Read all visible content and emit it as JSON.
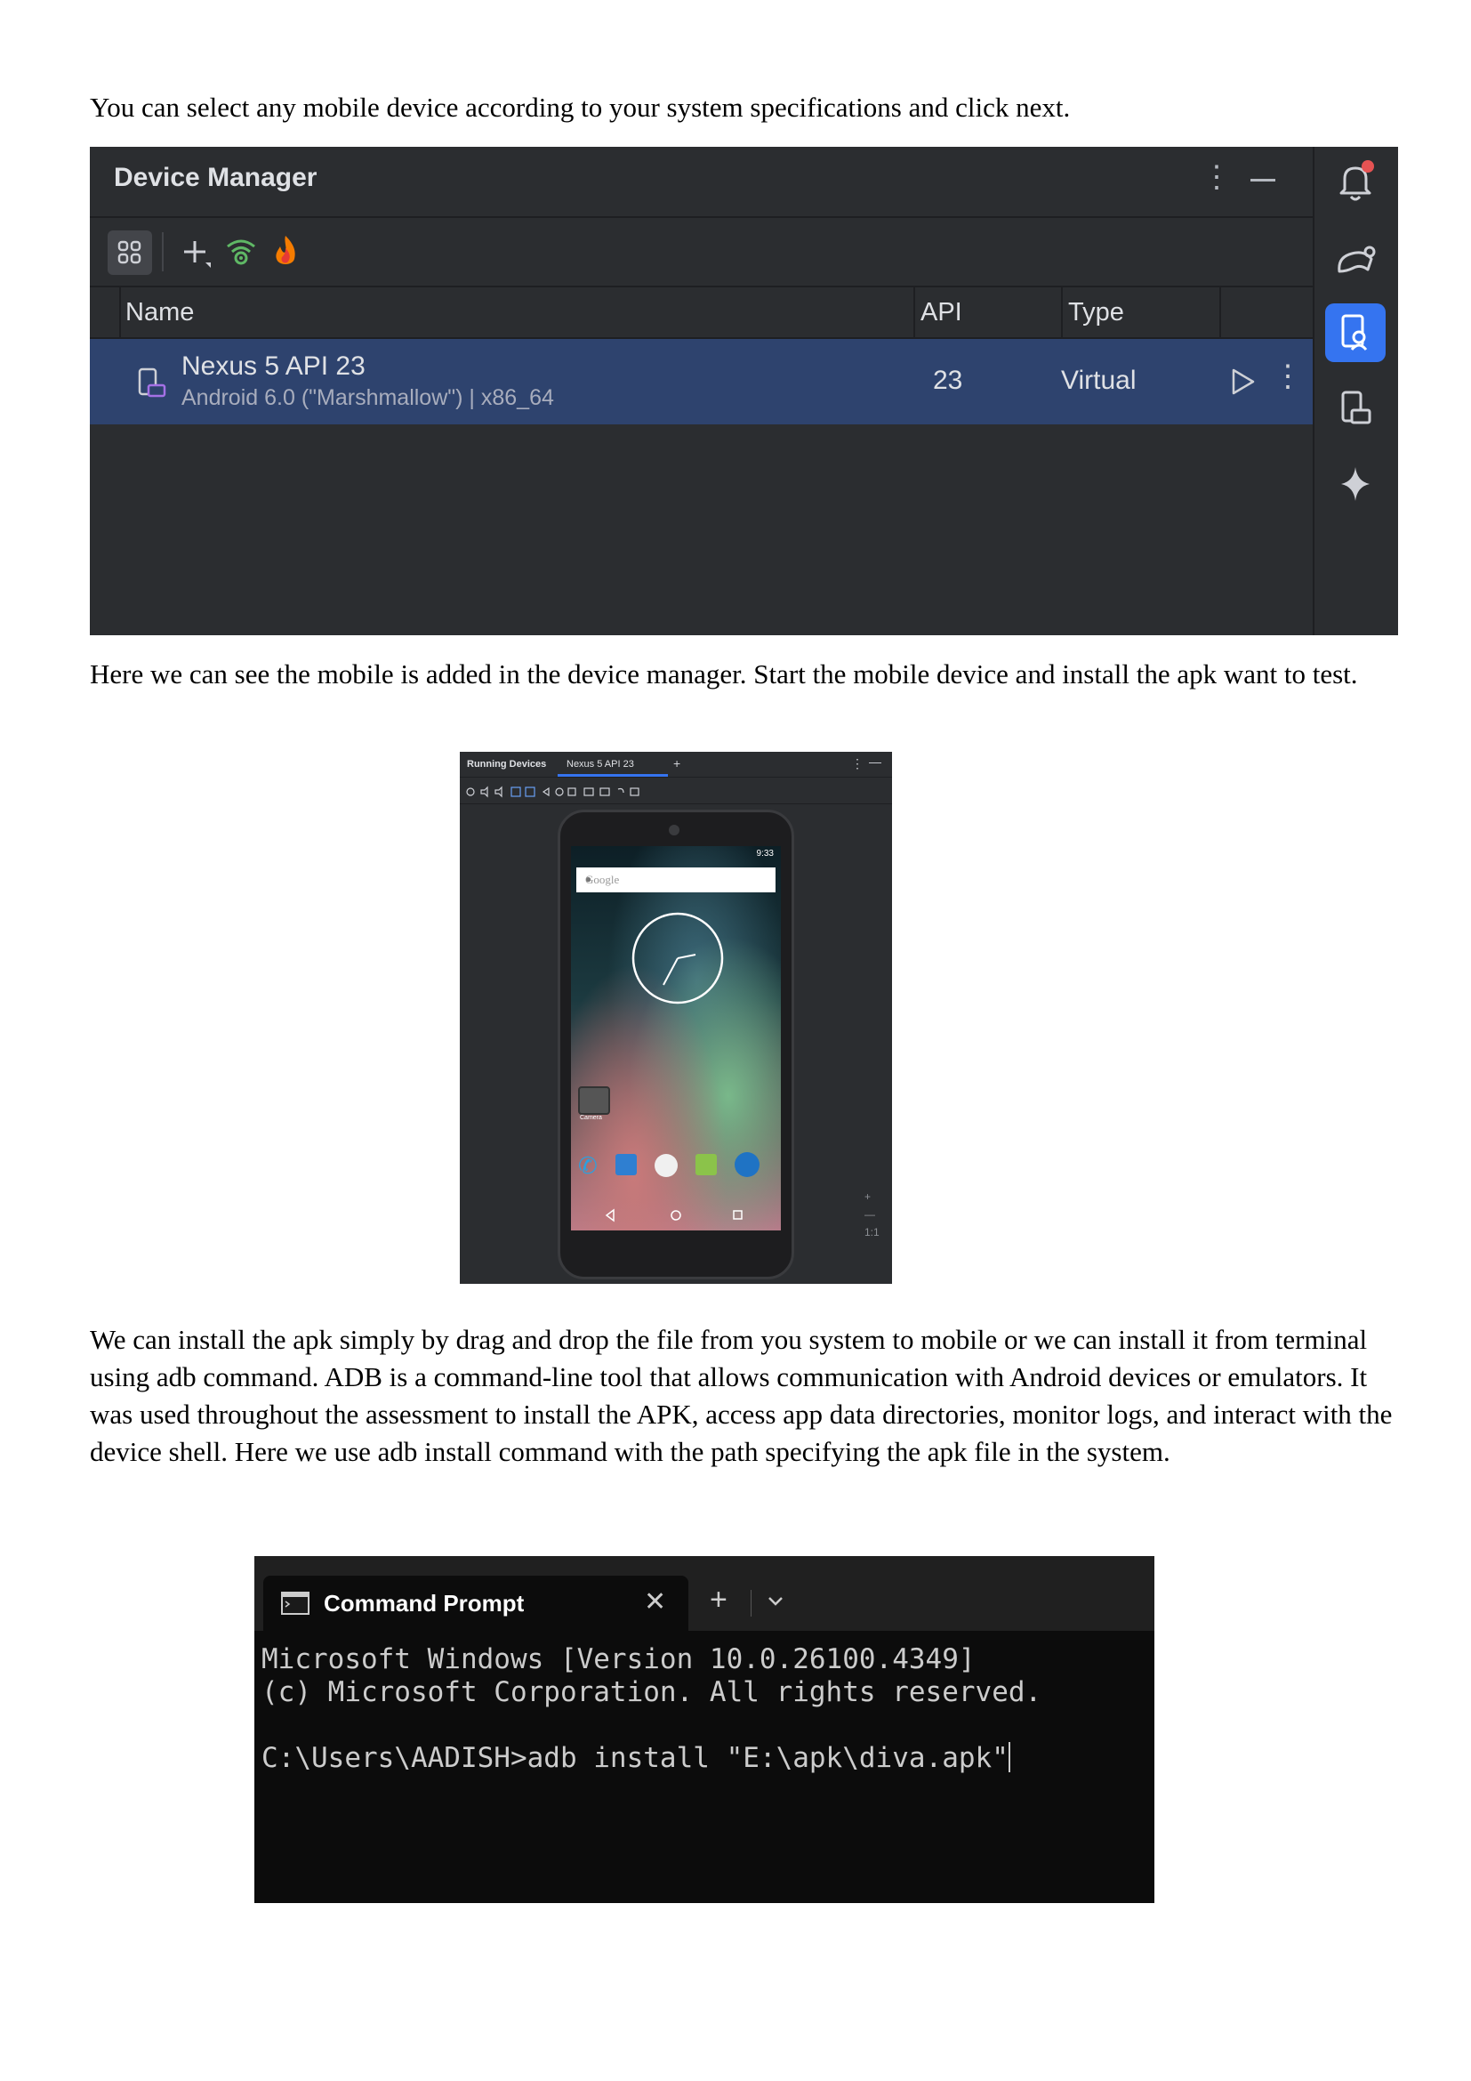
{
  "paragraphs": {
    "p1": "You can select any mobile device according to your system specifications and click next.",
    "p2": "Here we can see the mobile is added in the device manager. Start the mobile device and install the apk want to test.",
    "p3": "We can install the apk simply by drag and drop the file from you system to mobile or we can install it from terminal using adb command. ADB is a command-line tool that allows communication with Android devices or emulators. It was used throughout the assessment to install the APK, access app data directories, monitor logs, and interact with the device shell. Here we use adb install command with the path specifying the apk file in the system."
  },
  "device_manager": {
    "title": "Device Manager",
    "columns": {
      "name": "Name",
      "api": "API",
      "type": "Type"
    },
    "device": {
      "name": "Nexus 5 API 23",
      "subtitle": "Android 6.0 (\"Marshmallow\") | x86_64",
      "api": "23",
      "type": "Virtual"
    },
    "icons": [
      "device-manager-grid-icon",
      "add-device-icon",
      "wifi-pair-icon",
      "firebase-icon",
      "notifications-icon",
      "gemini-icon",
      "device-manager-icon",
      "running-devices-icon",
      "ai-assistant-icon",
      "run-icon",
      "more-icon"
    ],
    "colors": {
      "panel": "#2b2d30",
      "selected_row": "#2e436e",
      "accent": "#3574f0"
    }
  },
  "running_devices": {
    "tab_title": "Running Devices",
    "device_tab": "Nexus 5 API 23",
    "search_placeholder": "Google",
    "status_time": "9:33",
    "app_label": "Camera"
  },
  "command_prompt": {
    "tab_title": "Command Prompt",
    "line1": "Microsoft Windows [Version 10.0.26100.4349]",
    "line2": "(c) Microsoft Corporation. All rights reserved.",
    "prompt": "C:\\Users\\AADISH>adb install \"E:\\apk\\diva.apk\""
  }
}
